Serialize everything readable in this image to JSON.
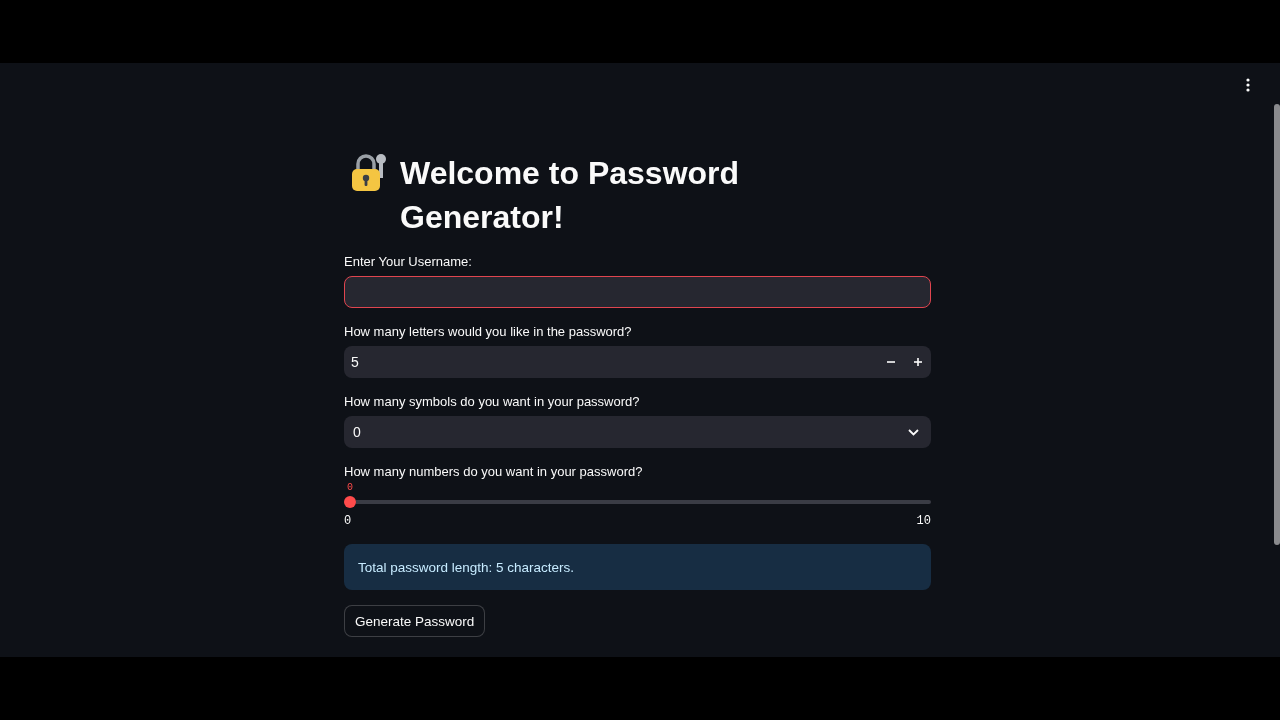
{
  "title": "Welcome to Password Generator!",
  "widgets": [
    {
      "kind": "text_input",
      "label": "Enter Your Username:",
      "focused": true
    },
    {
      "kind": "number_input",
      "label": "How many letters would you like in the password?",
      "value": "5"
    },
    {
      "kind": "select",
      "label": "How many symbols do you want in your password?",
      "value": "0"
    },
    {
      "kind": "slider",
      "label": "How many numbers do you want in your password?",
      "value": "0",
      "min": "0",
      "max": "10",
      "level": 0
    },
    {
      "kind": "info",
      "text": "Total password length: 5 characters."
    },
    {
      "kind": "button",
      "label": "Generate Password"
    }
  ]
}
